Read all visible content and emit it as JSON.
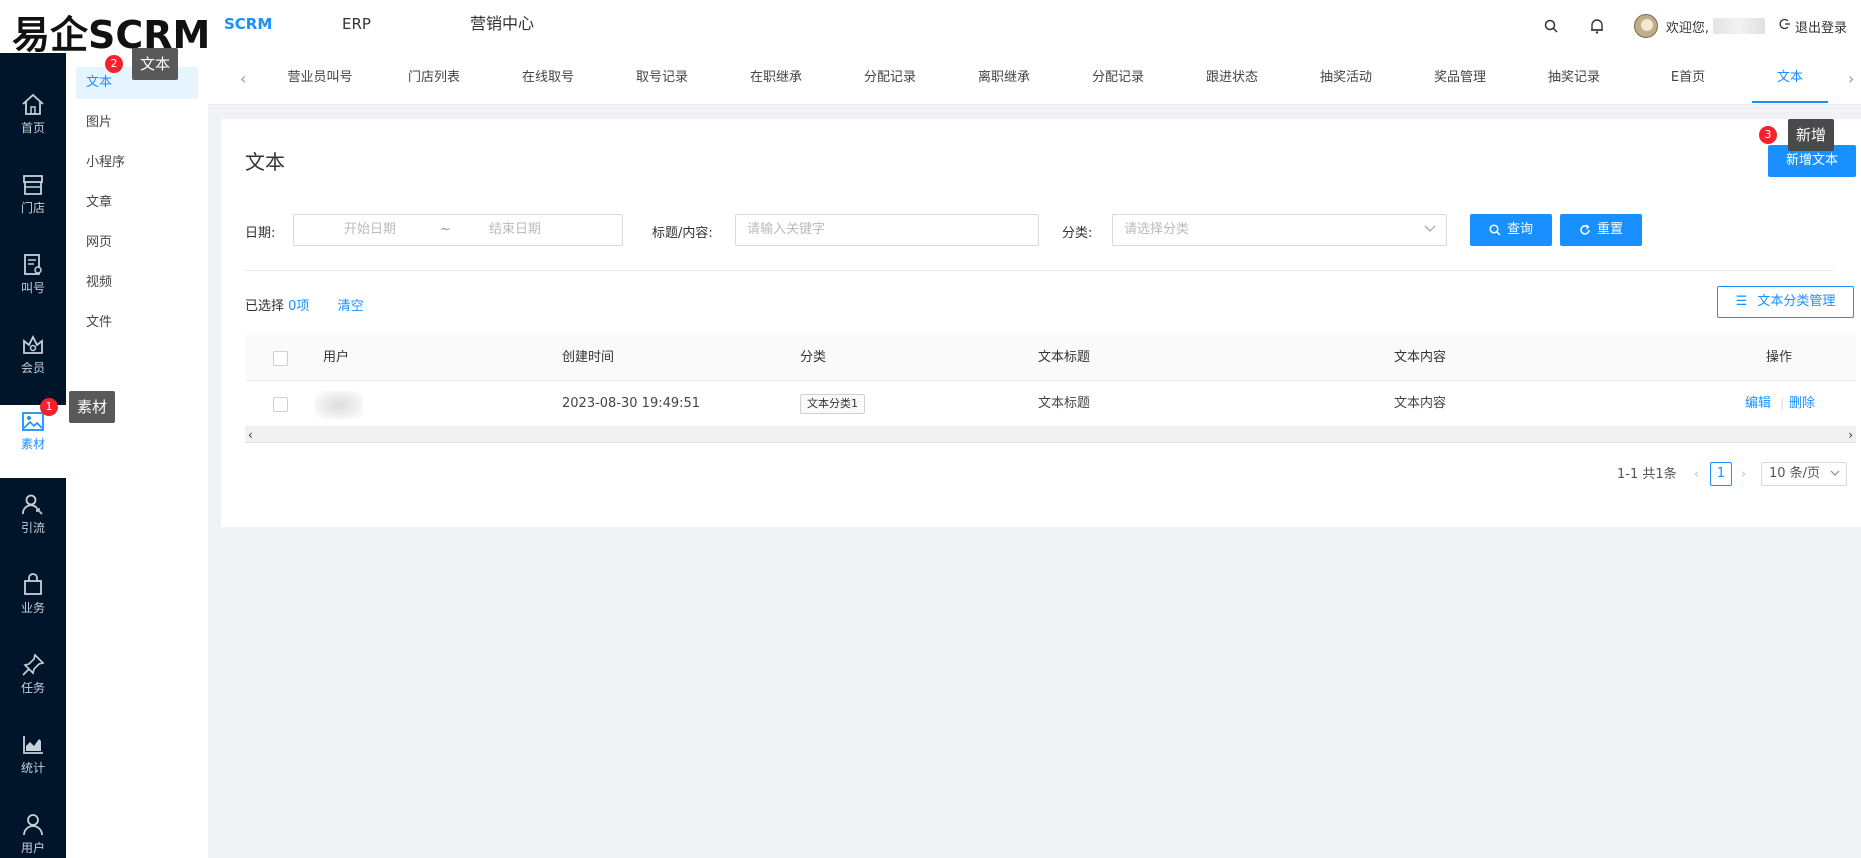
{
  "app": {
    "logo": "易企SCRM"
  },
  "topnav": {
    "items": [
      "SCRM",
      "ERP",
      "营销中心"
    ]
  },
  "user": {
    "welcome": "欢迎您,",
    "logout": "退出登录"
  },
  "sidebar": {
    "items": [
      {
        "label": "首页",
        "icon": "home-icon"
      },
      {
        "label": "门店",
        "icon": "store-icon"
      },
      {
        "label": "叫号",
        "icon": "queue-icon"
      },
      {
        "label": "会员",
        "icon": "member-icon"
      },
      {
        "label": "素材",
        "icon": "image-icon"
      },
      {
        "label": "引流",
        "icon": "traffic-icon"
      },
      {
        "label": "业务",
        "icon": "bag-icon"
      },
      {
        "label": "任务",
        "icon": "pin-icon"
      },
      {
        "label": "统计",
        "icon": "chart-icon"
      },
      {
        "label": "用户",
        "icon": "user-icon"
      }
    ]
  },
  "submenu": {
    "items": [
      "文本",
      "图片",
      "小程序",
      "文章",
      "网页",
      "视频",
      "文件"
    ]
  },
  "tabs": {
    "items": [
      "营业员叫号",
      "门店列表",
      "在线取号",
      "取号记录",
      "在职继承",
      "分配记录",
      "离职继承",
      "分配记录",
      "跟进状态",
      "抽奖活动",
      "奖品管理",
      "抽奖记录",
      "E首页",
      "文本"
    ]
  },
  "page": {
    "title": "文本",
    "add_button": "新增文本",
    "filters": {
      "date_label": "日期:",
      "start_placeholder": "开始日期",
      "separator": "~",
      "end_placeholder": "结束日期",
      "keyword_label": "标题/内容:",
      "keyword_placeholder": "请输入关键字",
      "category_label": "分类:",
      "category_placeholder": "请选择分类",
      "query_button": "查询",
      "reset_button": "重置"
    },
    "selection": {
      "prefix": "已选择",
      "count": "0项",
      "clear": "清空"
    },
    "category_manage": "文本分类管理",
    "table": {
      "columns": [
        "用户",
        "创建时间",
        "分类",
        "文本标题",
        "文本内容",
        "操作"
      ],
      "rows": [
        {
          "created": "2023-08-30 19:49:51",
          "category": "文本分类1",
          "title": "文本标题",
          "content": "文本内容",
          "edit": "编辑",
          "delete": "删除"
        }
      ]
    },
    "pagination": {
      "summary": "1-1 共1条",
      "current": "1",
      "page_size": "10 条/页"
    }
  },
  "tooltips": {
    "one": {
      "badge": "1",
      "text": "素材"
    },
    "two": {
      "badge": "2",
      "text": "文本"
    },
    "three": {
      "badge": "3",
      "text": "新增"
    }
  },
  "colors": {
    "primary": "#1890ff",
    "sidebar_bg": "#001529",
    "badge": "#f5222d",
    "tooltip_bg": "#595959"
  }
}
